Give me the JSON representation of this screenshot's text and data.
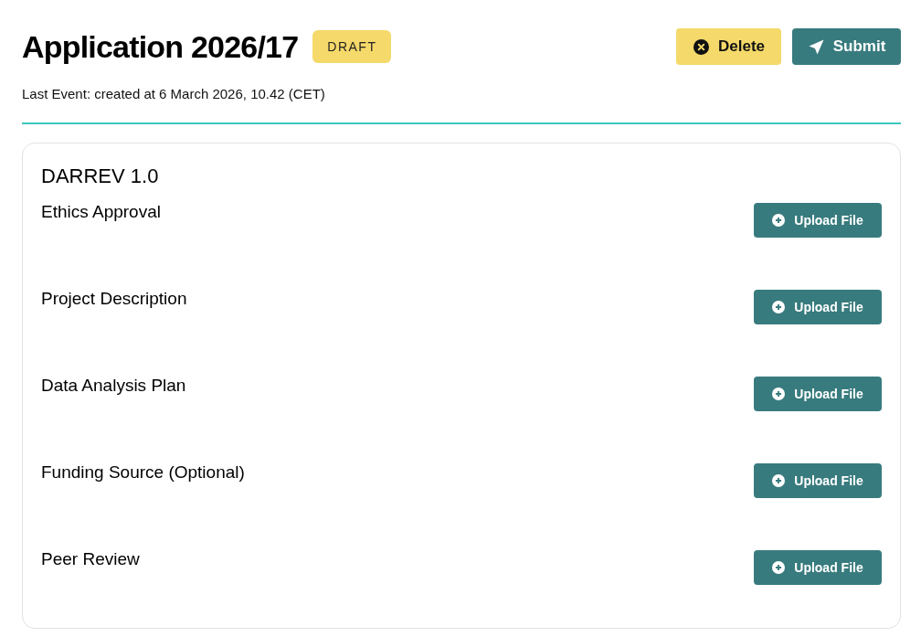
{
  "header": {
    "title": "Application 2026/17",
    "status": "DRAFT",
    "last_event": "Last Event: created at 6 March 2026, 10.42 (CET)",
    "actions": [
      {
        "kind": "delete",
        "label": "Delete"
      },
      {
        "kind": "submit",
        "label": "Submit"
      }
    ]
  },
  "form": {
    "title": "DARREV 1.0",
    "items": [
      {
        "label": "Ethics Approval",
        "action": "Upload File"
      },
      {
        "label": "Project Description",
        "action": "Upload File"
      },
      {
        "label": "Data Analysis Plan",
        "action": "Upload File"
      },
      {
        "label": "Funding Source (Optional)",
        "action": "Upload File"
      },
      {
        "label": "Peer Review",
        "action": "Upload File"
      }
    ]
  }
}
